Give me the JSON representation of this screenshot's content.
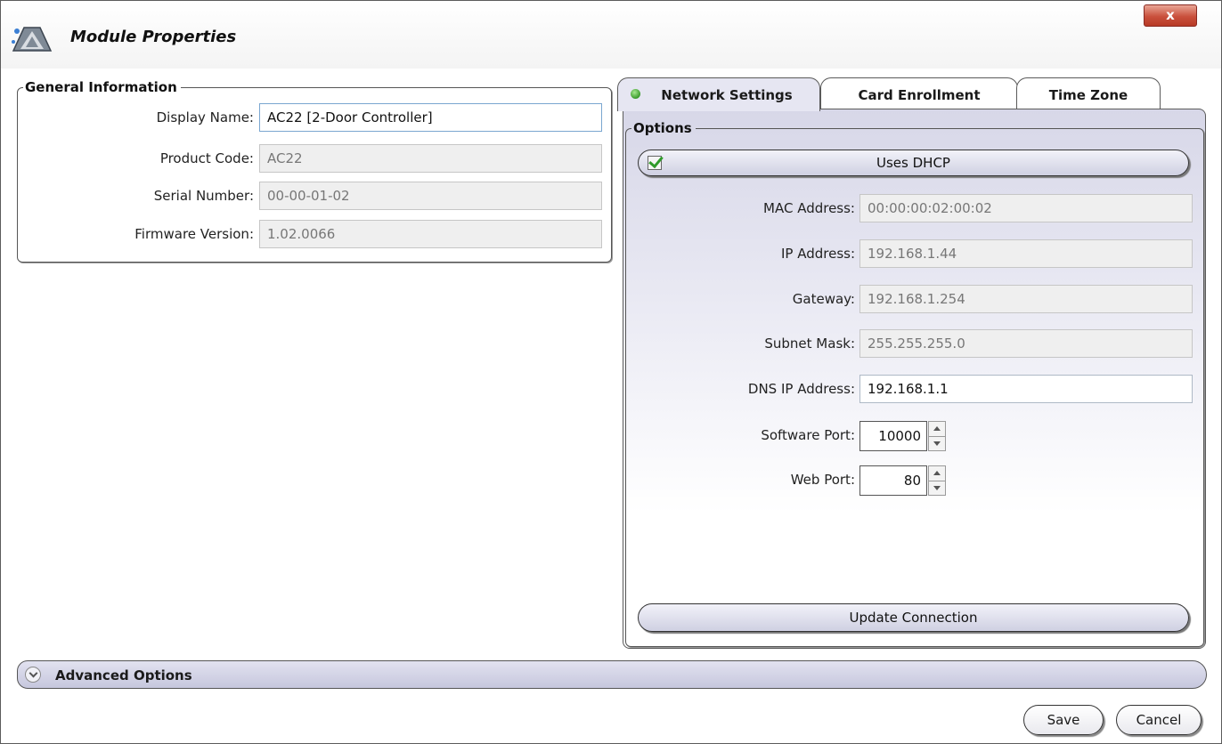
{
  "window": {
    "title": "Module Properties",
    "close_label": "x",
    "app_icon": "triangle-logo-icon",
    "close_icon": "close-icon"
  },
  "general_info": {
    "legend": "General Information",
    "display_name": {
      "label": "Display Name:",
      "value": "AC22 [2-Door Controller]"
    },
    "product_code": {
      "label": "Product Code:",
      "value": "AC22"
    },
    "serial_number": {
      "label": "Serial Number:",
      "value": "00-00-01-02"
    },
    "firmware_version": {
      "label": "Firmware Version:",
      "value": "1.02.0066"
    }
  },
  "tabs": [
    {
      "label": "Network Settings",
      "active": true
    },
    {
      "label": "Card Enrollment",
      "active": false
    },
    {
      "label": "Time Zone",
      "active": false
    }
  ],
  "network": {
    "legend": "Options",
    "uses_dhcp": {
      "label": "Uses DHCP",
      "checked": true
    },
    "mac_address": {
      "label": "MAC Address:",
      "value": "00:00:00:02:00:02"
    },
    "ip_address": {
      "label": "IP Address:",
      "value": "192.168.1.44"
    },
    "gateway": {
      "label": "Gateway:",
      "value": "192.168.1.254"
    },
    "subnet_mask": {
      "label": "Subnet Mask:",
      "value": "255.255.255.0"
    },
    "dns_ip": {
      "label": "DNS IP Address:",
      "value": "192.168.1.1"
    },
    "software_port": {
      "label": "Software Port:",
      "value": "10000"
    },
    "web_port": {
      "label": "Web Port:",
      "value": "80"
    },
    "update_button": "Update Connection"
  },
  "advanced": {
    "label": "Advanced Options",
    "icon": "chevron-down-icon"
  },
  "footer": {
    "save_label": "Save",
    "cancel_label": "Cancel"
  },
  "colors": {
    "status_led": "#3a9a2c",
    "close_button": "#c9503c",
    "panel_tint": "#d7d7e8"
  }
}
